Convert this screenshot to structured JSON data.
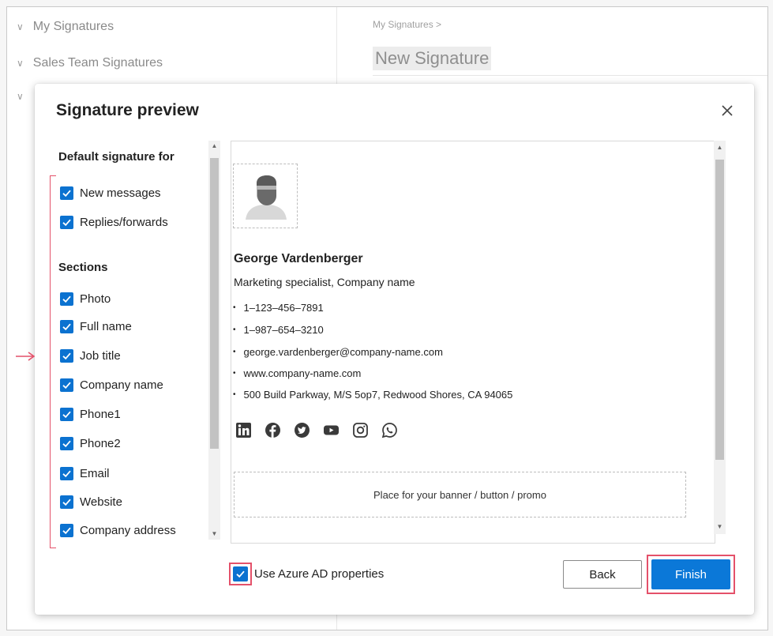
{
  "background": {
    "tree": [
      {
        "label": "My Signatures"
      },
      {
        "label": "Sales Team Signatures"
      }
    ],
    "breadcrumb": "My Signatures >",
    "page_title": "New Signature"
  },
  "dialog": {
    "title": "Signature preview",
    "default_for": {
      "heading": "Default signature for",
      "options": [
        {
          "label": "New messages",
          "checked": true
        },
        {
          "label": "Replies/forwards",
          "checked": true
        }
      ]
    },
    "sections": {
      "heading": "Sections",
      "options": [
        {
          "label": "Photo",
          "checked": true
        },
        {
          "label": "Full name",
          "checked": true
        },
        {
          "label": "Job title",
          "checked": true
        },
        {
          "label": "Company name",
          "checked": true
        },
        {
          "label": "Phone1",
          "checked": true
        },
        {
          "label": "Phone2",
          "checked": true
        },
        {
          "label": "Email",
          "checked": true
        },
        {
          "label": "Website",
          "checked": true
        },
        {
          "label": "Company address",
          "checked": true
        }
      ]
    },
    "preview": {
      "name": "George Vardenberger",
      "job": "Marketing specialist, Company name",
      "details": [
        "1–123–456–7891",
        "1–987–654–3210",
        "george.vardenberger@company-name.com",
        "www.company-name.com",
        "500 Build Parkway, M/S 5op7, Redwood Shores, CA 94065"
      ],
      "social_icons": [
        "linkedin-icon",
        "facebook-icon",
        "twitter-icon",
        "youtube-icon",
        "instagram-icon",
        "whatsapp-icon"
      ],
      "banner_text": "Place for your banner / button / promo"
    },
    "footer": {
      "azure_label": "Use Azure AD properties",
      "azure_checked": true,
      "back_label": "Back",
      "finish_label": "Finish"
    }
  },
  "colors": {
    "accent": "#0b78d8",
    "highlight": "#e4516a"
  }
}
